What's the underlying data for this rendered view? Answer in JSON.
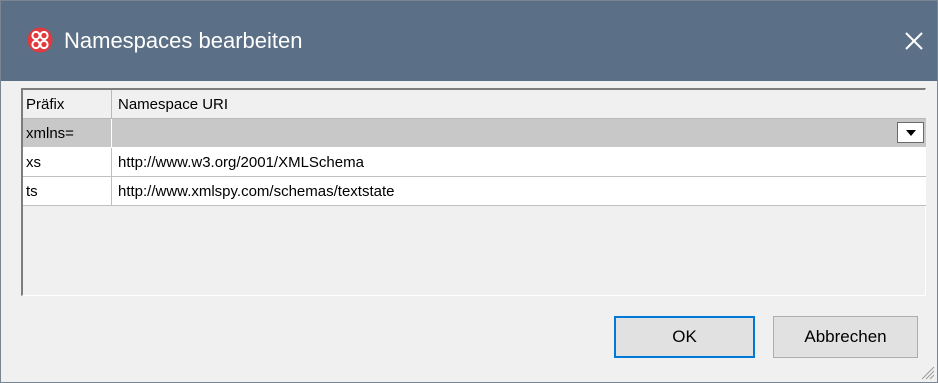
{
  "window": {
    "title": "Namespaces bearbeiten",
    "app_icon": "xmlspy-logo-icon",
    "close_icon": "close-icon"
  },
  "grid": {
    "columns": [
      "Präfix",
      "Namespace URI"
    ],
    "namespace_row": {
      "prefix": "xmlns=",
      "uri": "",
      "dropdown_icon": "dropdown-arrow-icon"
    },
    "rows": [
      {
        "prefix": "xs",
        "uri": "http://www.w3.org/2001/XMLSchema"
      },
      {
        "prefix": "ts",
        "uri": "http://www.xmlspy.com/schemas/textstate"
      }
    ]
  },
  "buttons": {
    "ok": "OK",
    "cancel": "Abbrechen"
  },
  "colors": {
    "titlebar": "#5b6f86",
    "icon_red": "#e0393e",
    "focus_border": "#0078d7"
  }
}
